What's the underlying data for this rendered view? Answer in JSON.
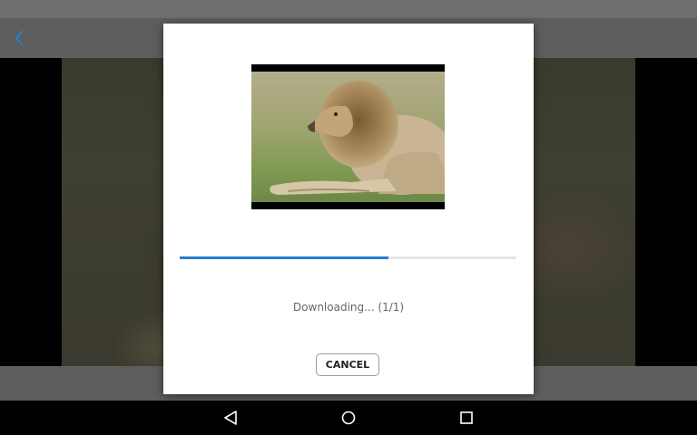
{
  "dialog": {
    "progress": 0.62,
    "status_text": "Downloading... (1/1)",
    "cancel_label": "CANCEL"
  },
  "icons": {
    "back": "back-arrow-icon",
    "nav_back": "nav-back-icon",
    "nav_home": "nav-home-icon",
    "nav_recents": "nav-recents-icon"
  },
  "colors": {
    "accent": "#2a7bd4",
    "app_bar": "#5e5e5e",
    "status_bar": "#6f6f6f"
  }
}
